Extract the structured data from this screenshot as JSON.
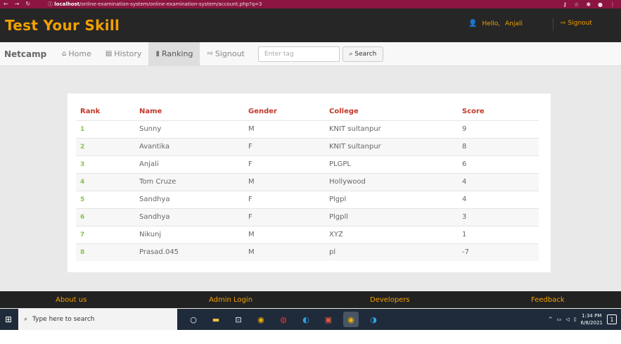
{
  "browser": {
    "url_host": "localhost",
    "url_path": "/online-examination-system/online-examination-system/account.php?q=3",
    "icons": [
      "back-icon",
      "forward-icon",
      "reload-icon",
      "info-icon",
      "key-icon",
      "star-icon",
      "extensions-icon",
      "profile-icon",
      "menu-icon"
    ]
  },
  "header": {
    "title": "Test Your Skill",
    "greeting": "Hello,",
    "username": "Anjali",
    "signout": "Signout",
    "accent_color": "#f2a000"
  },
  "navbar": {
    "brand": "Netcamp",
    "items": [
      {
        "label": "Home",
        "icon": "home-icon"
      },
      {
        "label": "History",
        "icon": "history-icon"
      },
      {
        "label": "Ranking",
        "icon": "ranking-icon",
        "active": true
      },
      {
        "label": "Signout",
        "icon": "signout-icon"
      }
    ],
    "search_placeholder": "Enter tag",
    "search_button": "Search"
  },
  "ranking": {
    "headers": [
      "Rank",
      "Name",
      "Gender",
      "College",
      "Score"
    ],
    "rows": [
      {
        "rank": "1",
        "name": "Sunny",
        "gender": "M",
        "college": "KNIT sultanpur",
        "score": "9"
      },
      {
        "rank": "2",
        "name": "Avantika",
        "gender": "F",
        "college": "KNIT sultanpur",
        "score": "8"
      },
      {
        "rank": "3",
        "name": "Anjali",
        "gender": "F",
        "college": "PLGPL",
        "score": "6"
      },
      {
        "rank": "4",
        "name": "Tom Cruze",
        "gender": "M",
        "college": "Hollywood",
        "score": "4"
      },
      {
        "rank": "5",
        "name": "Sandhya",
        "gender": "F",
        "college": "Plgpl",
        "score": "4"
      },
      {
        "rank": "6",
        "name": "Sandhya",
        "gender": "F",
        "college": "Plgpll",
        "score": "3"
      },
      {
        "rank": "7",
        "name": "Nikunj",
        "gender": "M",
        "college": "XYZ",
        "score": "1"
      },
      {
        "rank": "8",
        "name": "Prasad.045",
        "gender": "M",
        "college": "pl",
        "score": "-7"
      }
    ]
  },
  "footer": {
    "links": [
      "About us",
      "Admin Login",
      "Developers",
      "Feedback"
    ]
  },
  "taskbar": {
    "search_placeholder": "Type here to search",
    "time": "1:34 PM",
    "date": "6/8/2021"
  }
}
